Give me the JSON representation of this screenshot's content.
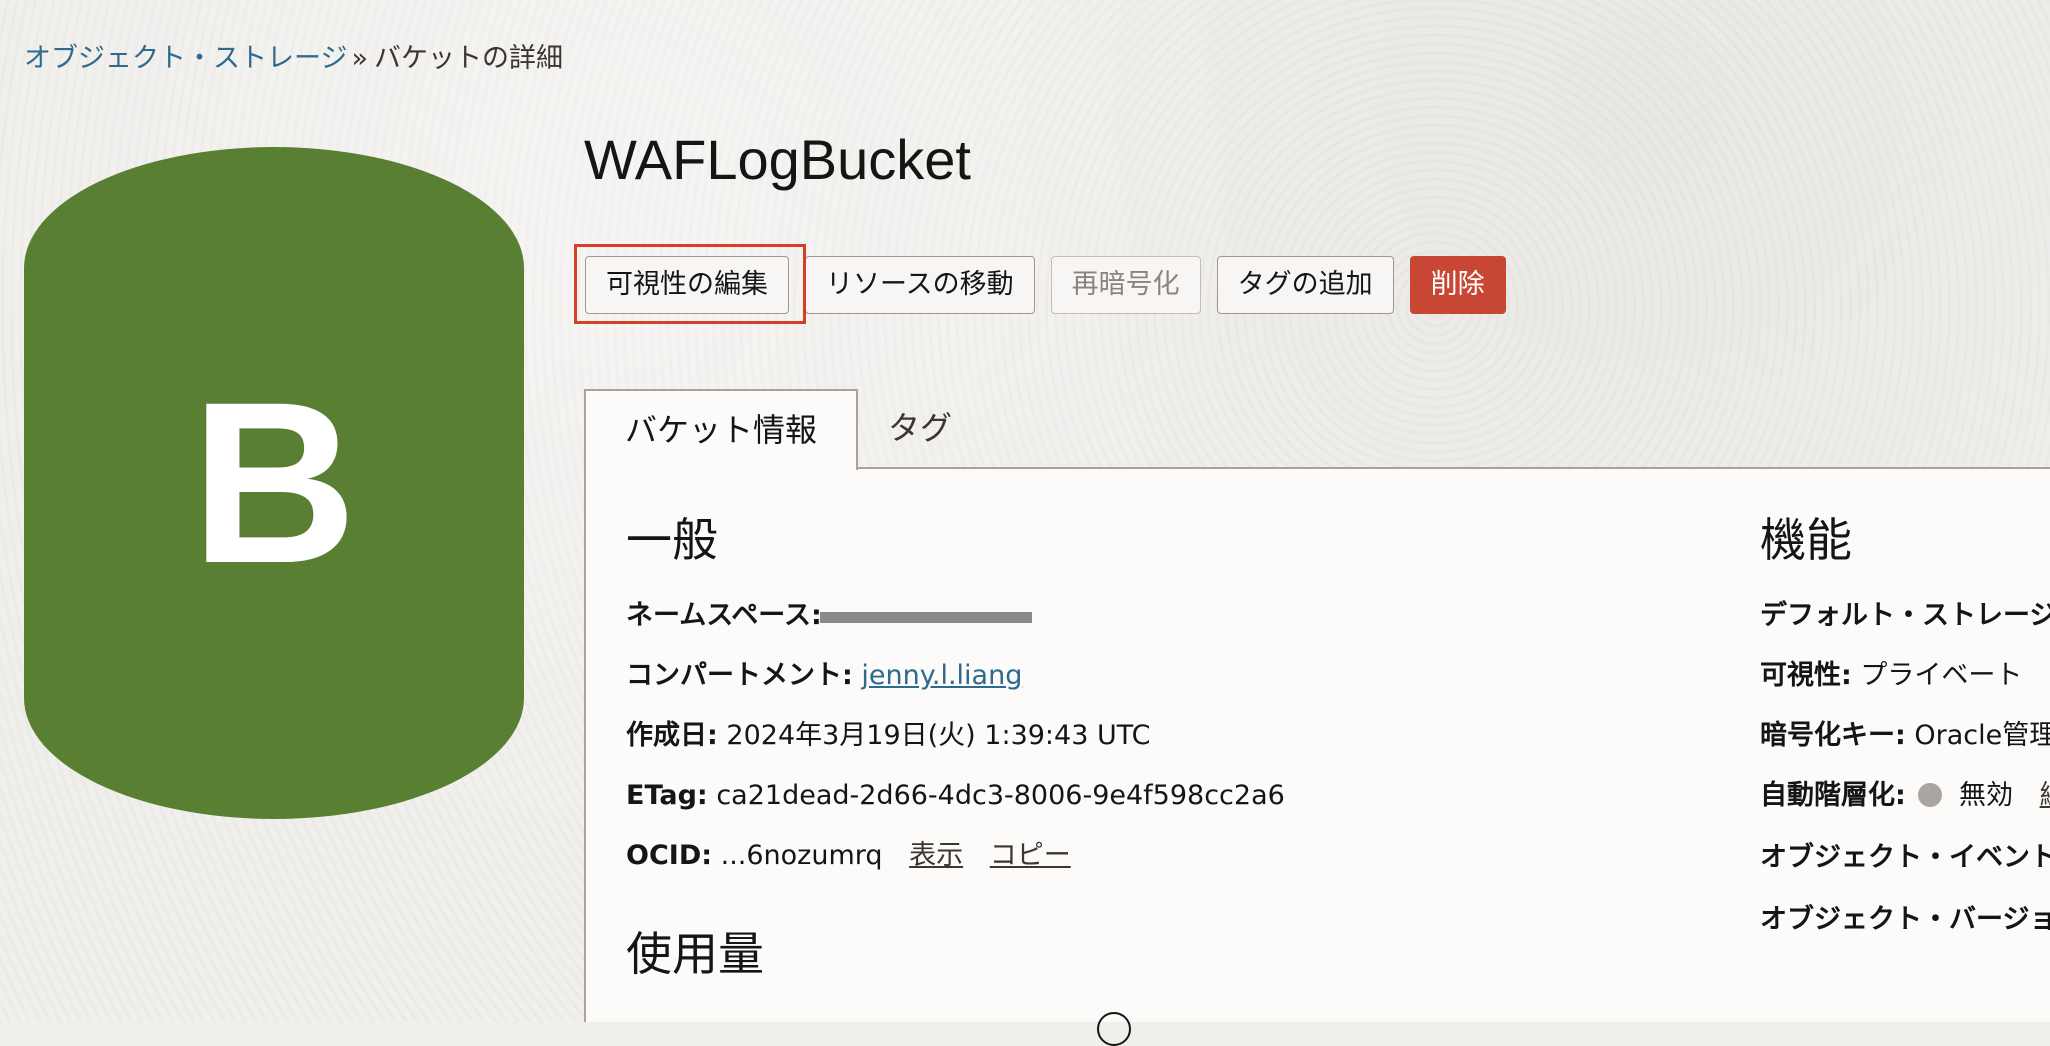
{
  "breadcrumb": {
    "root": "オブジェクト・ストレージ",
    "separator": "»",
    "current": "バケットの詳細"
  },
  "bucket": {
    "logo_letter": "B",
    "logo_color": "#587f32",
    "name": "WAFLogBucket"
  },
  "actions": {
    "edit_visibility": "可視性の編集",
    "move_resource": "リソースの移動",
    "reencrypt": "再暗号化",
    "add_tags": "タグの追加",
    "delete": "削除"
  },
  "tabs": {
    "bucket_info": "バケット情報",
    "tags": "タグ"
  },
  "general": {
    "heading": "一般",
    "namespace_label": "ネームスペース:",
    "compartment_label": "コンパートメント:",
    "compartment_value": "jenny.l.liang",
    "created_label": "作成日:",
    "created_value": "2024年3月19日(火) 1:39:43 UTC",
    "etag_label": "ETag:",
    "etag_value": "ca21dead-2d66-4dc3-8006-9e4f598cc2a6",
    "ocid_label": "OCID:",
    "ocid_value": "...6nozumrq",
    "ocid_show": "表示",
    "ocid_copy": "コピー"
  },
  "usage": {
    "heading": "使用量"
  },
  "features": {
    "heading": "機能",
    "default_storage_label": "デフォルト・ストレージ",
    "visibility_label": "可視性:",
    "visibility_value": "プライベート",
    "encryption_label": "暗号化キー:",
    "encryption_value": "Oracle管理",
    "auto_tiering_label": "自動階層化:",
    "auto_tiering_value": "無効",
    "auto_tiering_edit": "編集",
    "object_events_label": "オブジェクト・イベント",
    "object_versioning_label": "オブジェクト・バージョ"
  },
  "colors": {
    "accent_link": "#2e6a8e",
    "danger": "#c74634",
    "highlight": "#d2402a"
  }
}
